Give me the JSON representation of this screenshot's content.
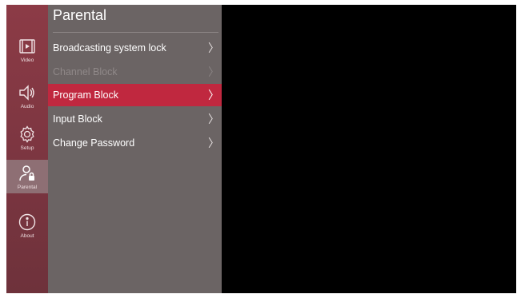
{
  "rail": {
    "items": [
      {
        "label": "Video",
        "icon": "video-icon",
        "active": false
      },
      {
        "label": "Audio",
        "icon": "speaker-icon",
        "active": false
      },
      {
        "label": "Setup",
        "icon": "gear-icon",
        "active": false
      },
      {
        "label": "Parental",
        "icon": "user-lock-icon",
        "active": true
      },
      {
        "label": "About",
        "icon": "info-icon",
        "active": false
      }
    ]
  },
  "panel": {
    "title": "Parental",
    "items": [
      {
        "label": "Broadcasting system lock",
        "chevron": "〉",
        "state": "normal"
      },
      {
        "label": "Channel Block",
        "chevron": "〉",
        "state": "disabled"
      },
      {
        "label": "Program Block",
        "chevron": "〉",
        "state": "selected"
      },
      {
        "label": "Input Block",
        "chevron": "〉",
        "state": "normal"
      },
      {
        "label": "Change Password",
        "chevron": "〉",
        "state": "normal"
      }
    ]
  },
  "colors": {
    "rail_bg": "#7a3540",
    "rail_active": "#8e6f74",
    "panel_bg": "#6b6464",
    "selected": "#c0283f",
    "screen_bg": "#000000"
  }
}
